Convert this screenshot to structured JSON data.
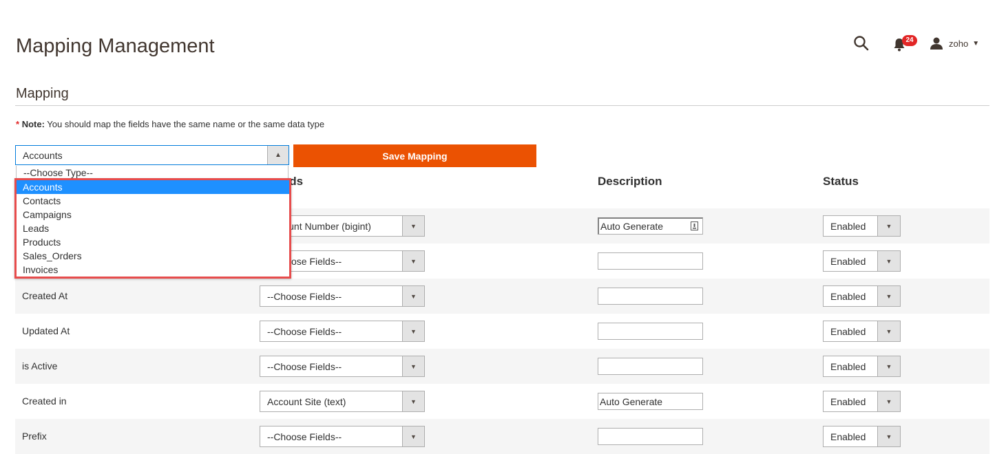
{
  "header": {
    "page_title": "Mapping Management",
    "notification_count": "24",
    "user_name": "zoho"
  },
  "section": {
    "title": "Mapping",
    "note_star": "*",
    "note_label": "Note:",
    "note_text": " You should map the fields have the same name or the same data type"
  },
  "type_select": {
    "value": "Accounts",
    "placeholder": "--Choose Type--",
    "options": [
      "Accounts",
      "Contacts",
      "Campaigns",
      "Leads",
      "Products",
      "Sales_Orders",
      "Invoices"
    ],
    "selected": "Accounts"
  },
  "save_button": "Save Mapping",
  "columns": {
    "crm_fields": "crm Fields",
    "description": "Description",
    "status": "Status"
  },
  "rows": [
    {
      "label": "",
      "field": "Account Number (bigint)",
      "description": "Auto Generate",
      "status": "Enabled"
    },
    {
      "label": "",
      "field": "--Choose Fields--",
      "description": "",
      "status": "Enabled"
    },
    {
      "label": "Created At",
      "field": "--Choose Fields--",
      "description": "",
      "status": "Enabled"
    },
    {
      "label": "Updated At",
      "field": "--Choose Fields--",
      "description": "",
      "status": "Enabled"
    },
    {
      "label": "is Active",
      "field": "--Choose Fields--",
      "description": "",
      "status": "Enabled"
    },
    {
      "label": "Created in",
      "field": "Account Site (text)",
      "description": "Auto Generate",
      "status": "Enabled"
    },
    {
      "label": "Prefix",
      "field": "--Choose Fields--",
      "description": "",
      "status": "Enabled"
    }
  ]
}
